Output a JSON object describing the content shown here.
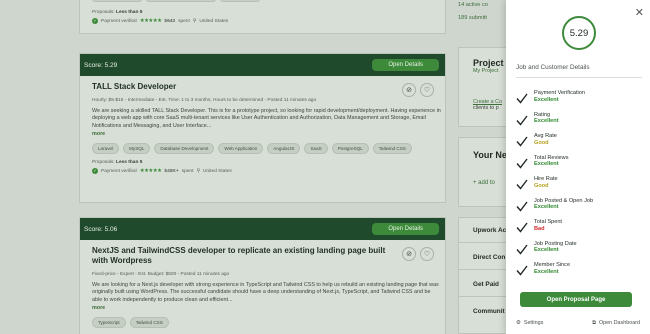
{
  "card0": {
    "proposals_label": "Proposals:",
    "proposals_value": "Less than 5",
    "payment": "Payment verified",
    "spent": "$643",
    "spent_suffix": "spent",
    "location": "United States"
  },
  "card1": {
    "score": "Score:  5.29",
    "open_label": "Open Details",
    "title": "TALL Stack Developer",
    "meta": "Hourly: $5-$15 - Intermediate - Est. Time: 1 to 3 months, Hours to be determined - Posted 11 minutes ago",
    "desc": "We are seeking a skilled TALL Stack Developer. This is for a prototype project, so looking for rapid development/deployment. Having experience in deploying a web app with core SaaS multi-tenant services like User Authentication and Authorization, Data Management and Storage, Email Notifications and Messaging, and User Interface...",
    "more": "more",
    "tags": [
      "Laravel",
      "MySQL",
      "Database Development",
      "Web Application",
      "AngularJS",
      "SaaS",
      "PostgreSQL",
      "Tailwind CSS"
    ],
    "proposals_label": "Proposals:",
    "proposals_value": "Less than 5",
    "payment": "Payment verified",
    "spent": "$40K+",
    "spent_suffix": "spent",
    "location": "United States"
  },
  "card2": {
    "score": "Score:  5.06",
    "open_label": "Open Details",
    "title": "NextJS and TailwindCSS developer to replicate an existing landing page built with Wordpress",
    "meta": "Fixed-price - Expert - Est. Budget: $500 - Posted 11 minutes ago",
    "desc": "We are looking for a Next.js developer with strong experience in TypeScript and Tailwind CSS to help us rebuild an existing landing page that was originally built using WordPress. The successful candidate should have a deep understanding of Next.js, TypeScript, and Tailwind CSS and be able to work independently to produce clean and efficient...",
    "more": "more",
    "tags": [
      "TypeScript",
      "Tailwind CSS"
    ]
  },
  "right": {
    "active": "14 active co",
    "submitted": "189 submitt",
    "project_title": "Project",
    "project_sub": "My Project",
    "create_link": "Create a Co",
    "create_text": "clients to p",
    "your_new": "Your Ne",
    "add_to": "add to",
    "upwork_ac": "Upwork Ac",
    "direct_con": "Direct Con",
    "get_paid": "Get Paid",
    "community": "Communit"
  },
  "panel": {
    "score": "5.29",
    "title": "Job and Customer Details",
    "items": [
      {
        "name": "Payment Verification",
        "value": "Excellent",
        "color": "#2f8a2f"
      },
      {
        "name": "Rating",
        "value": "Excellent",
        "color": "#2f8a2f"
      },
      {
        "name": "Avg Rate",
        "value": "Good",
        "color": "#b5a21e"
      },
      {
        "name": "Total Reviews",
        "value": "Excellent",
        "color": "#2f8a2f"
      },
      {
        "name": "Hire Rate",
        "value": "Good",
        "color": "#b5a21e"
      },
      {
        "name": "Job Posted & Open Job",
        "value": "Excellent",
        "color": "#2f8a2f"
      },
      {
        "name": "Total Spent",
        "value": "Bad",
        "color": "#d22a2a"
      },
      {
        "name": "Job Posting Date",
        "value": "Excellent",
        "color": "#2f8a2f"
      },
      {
        "name": "Member Since",
        "value": "Excellent",
        "color": "#2f8a2f"
      }
    ],
    "button": "Open Proposal Page",
    "settings": "Settings",
    "dashboard": "Open Dashboard"
  },
  "colors": {
    "accent": "#3d8a3a",
    "header": "#1f4a2c"
  }
}
